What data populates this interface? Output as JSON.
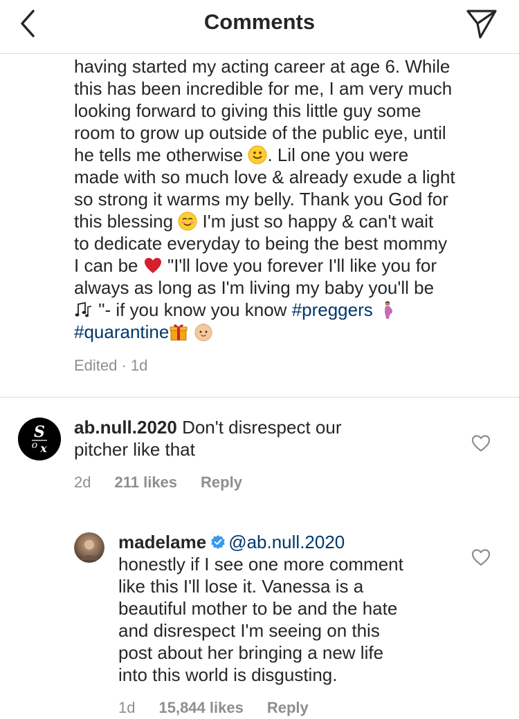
{
  "header": {
    "title": "Comments",
    "back_icon": "chevron-left-icon",
    "send_icon": "paper-plane-icon"
  },
  "caption": {
    "lines": [
      "having started my acting career at age 6. While",
      "this has been incredible for me, I am very much",
      "looking forward to giving this little guy some",
      "room to grow up outside of the public eye, until"
    ],
    "line5a": "he tells me otherwise ",
    "line5b": ". Lil one you were",
    "line6": "made with so much love & already exude a light",
    "line7": "so strong it warms my belly. Thank you God for",
    "line8a": "this blessing ",
    "line8b": " I'm just so happy & can't wait",
    "line9": "to dedicate everyday to being the best mommy",
    "line10a": "I can be ",
    "line10b": " \"I'll love you forever I'll like you for",
    "line11": "always as long as I'm living my baby you'll be",
    "line12a": " \"- if you know you know ",
    "hashtag1": "#preggers",
    "hashtag2": "#quarantine",
    "meta": "Edited · 1d"
  },
  "comments": [
    {
      "username": "ab.null.2020",
      "text_line1": " Don't disrespect our",
      "text_line2": "pitcher like that",
      "age": "2d",
      "likes": "211 likes",
      "reply": "Reply",
      "avatar_icon": "sox-logo-avatar"
    },
    {
      "username": "madelame",
      "mention": "@ab.null.2020",
      "lines": [
        "honestly if I see one more comment",
        "like this I'll lose it. Vanessa is a",
        "beautiful mother to be and the hate",
        "and disrespect I'm seeing on this",
        "post about her bringing a new life",
        "into this world is disgusting."
      ],
      "age": "1d",
      "likes": "15,844 likes",
      "reply": "Reply",
      "verified_icon": "verified-badge-icon"
    }
  ],
  "colors": {
    "text": "#262626",
    "muted": "#8e8e8e",
    "link": "#00376b",
    "verified": "#3897f0",
    "divider": "#dbdbdb"
  }
}
